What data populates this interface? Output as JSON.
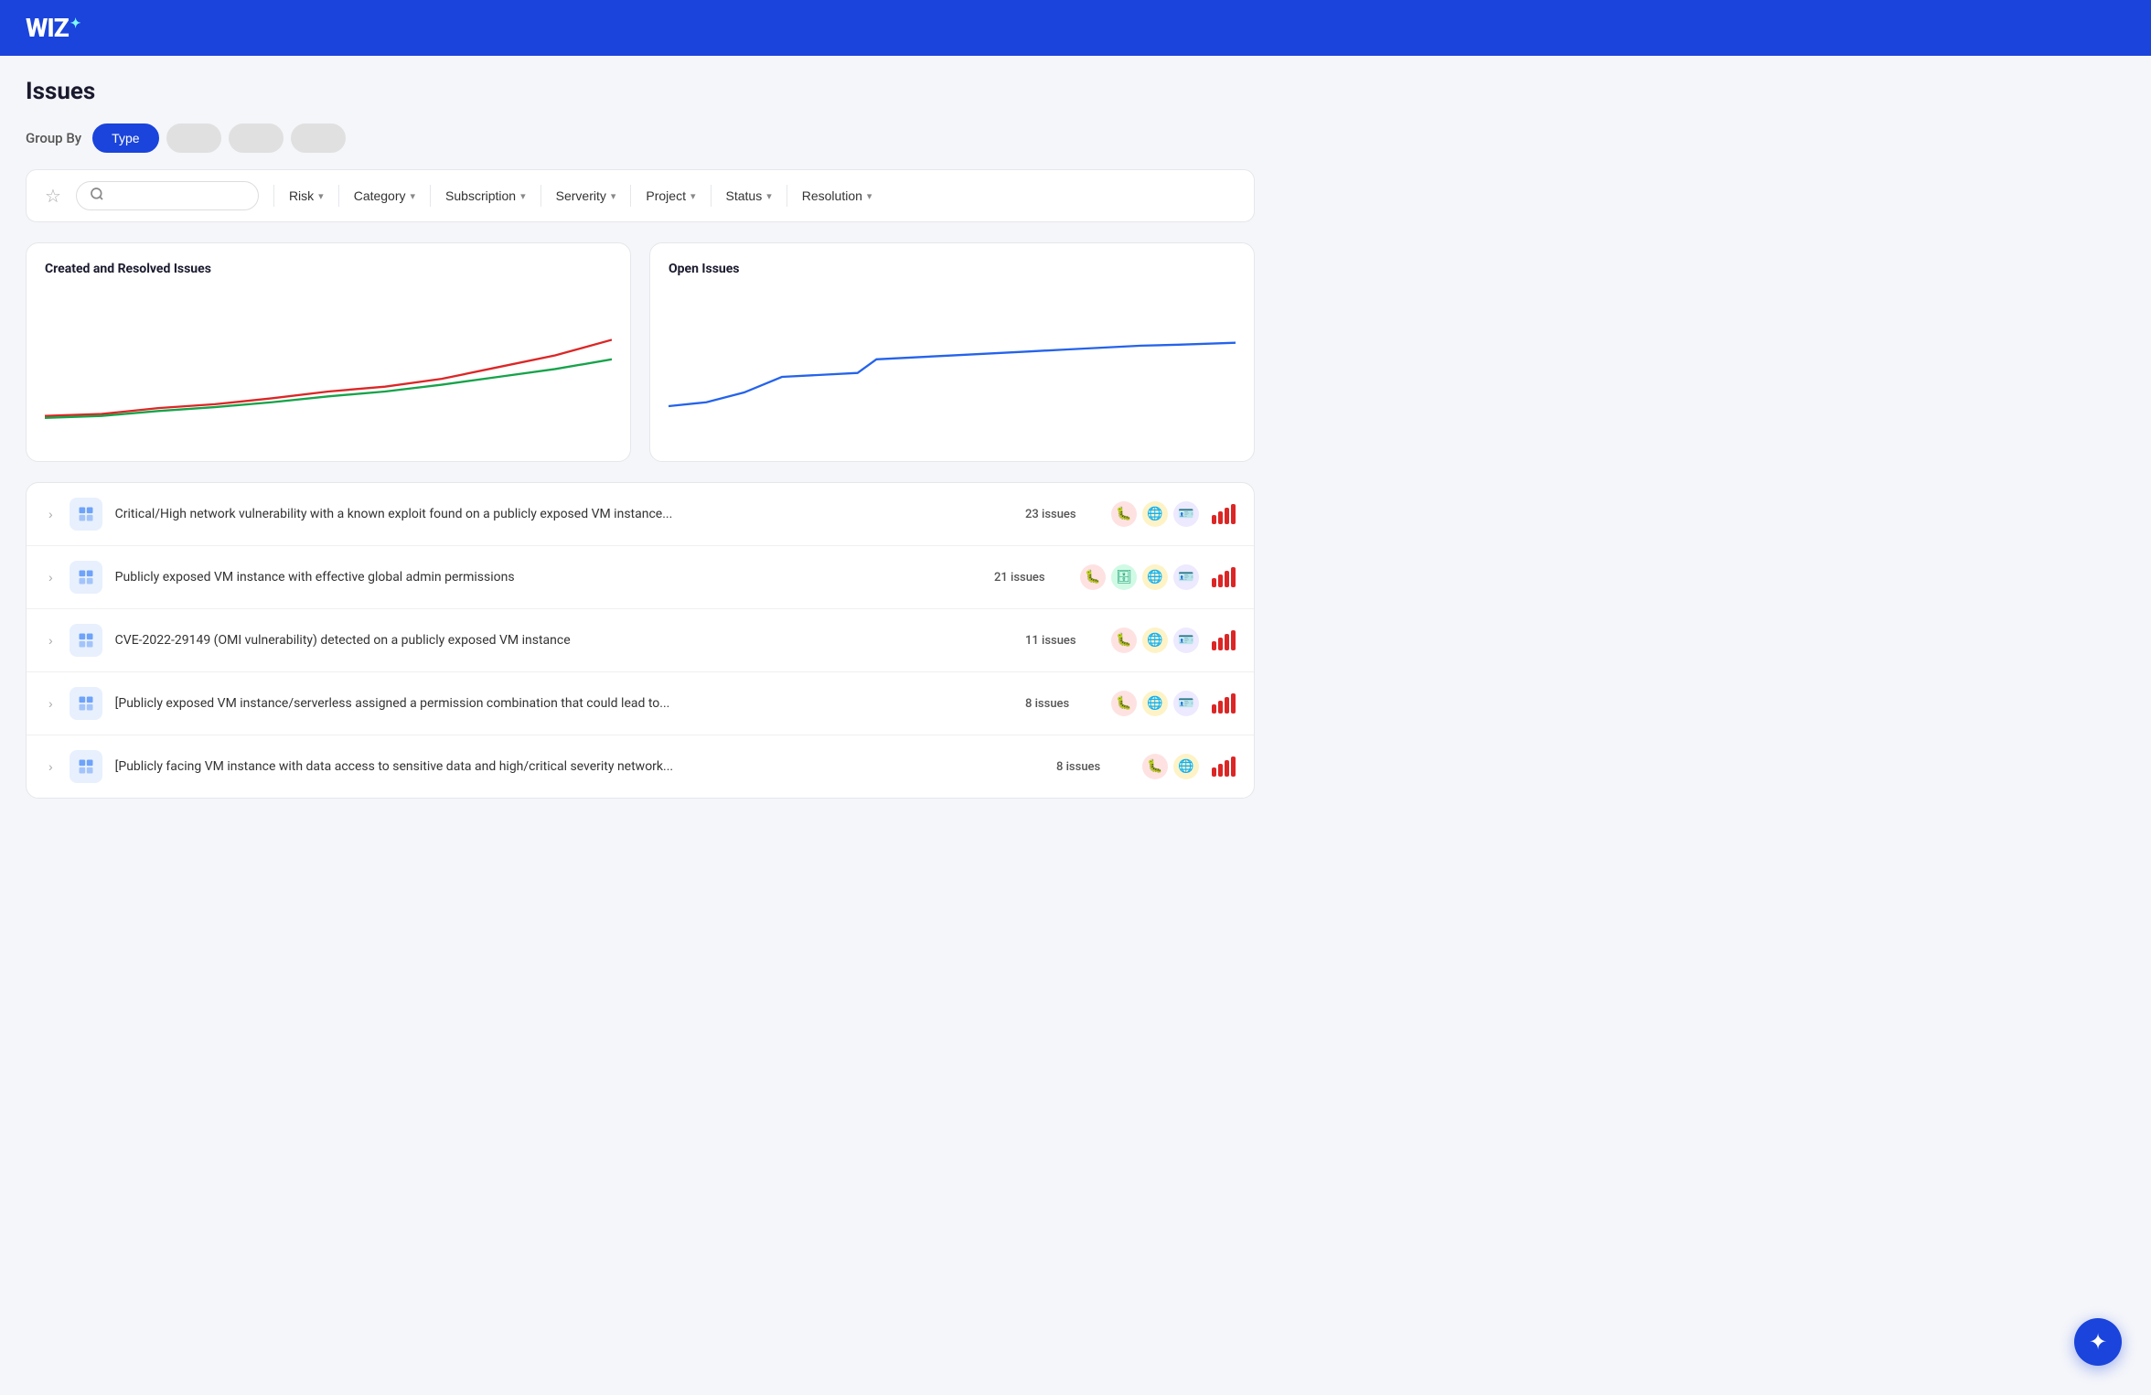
{
  "header": {
    "logo": "WIZ",
    "logo_star": "✦"
  },
  "page": {
    "title": "Issues"
  },
  "group_by": {
    "label": "Group By",
    "buttons": [
      {
        "id": "type",
        "label": "Type",
        "active": true
      },
      {
        "id": "btn2",
        "label": "",
        "active": false,
        "placeholder": true
      },
      {
        "id": "btn3",
        "label": "",
        "active": false,
        "placeholder": true
      },
      {
        "id": "btn4",
        "label": "",
        "active": false,
        "placeholder": true
      }
    ]
  },
  "filters": {
    "star_label": "☆",
    "search_placeholder": "",
    "items": [
      {
        "id": "risk",
        "label": "Risk"
      },
      {
        "id": "category",
        "label": "Category"
      },
      {
        "id": "subscription",
        "label": "Subscription"
      },
      {
        "id": "severity",
        "label": "Serverity"
      },
      {
        "id": "project",
        "label": "Project"
      },
      {
        "id": "status",
        "label": "Status"
      },
      {
        "id": "resolution",
        "label": "Resolution"
      }
    ]
  },
  "charts": {
    "left": {
      "title": "Created and Resolved Issues"
    },
    "right": {
      "title": "Open Issues"
    }
  },
  "issues": [
    {
      "id": 1,
      "text": "Critical/High network vulnerability with a known exploit found on a publicly exposed VM instance...",
      "count": "23 issues",
      "tags": [
        "bug-red",
        "globe-orange",
        "id-purple"
      ],
      "bars": [
        4,
        4,
        4,
        4
      ]
    },
    {
      "id": 2,
      "text": "Publicly exposed VM instance with effective global admin permissions",
      "count": "21 issues",
      "tags": [
        "bug-red",
        "db-green",
        "globe-orange",
        "id-purple"
      ],
      "bars": [
        4,
        4,
        4,
        4
      ]
    },
    {
      "id": 3,
      "text": "CVE-2022-29149 (OMI vulnerability) detected on a publicly exposed VM instance",
      "count": "11 issues",
      "tags": [
        "bug-red",
        "globe-orange",
        "id-purple"
      ],
      "bars": [
        4,
        4,
        4,
        4
      ]
    },
    {
      "id": 4,
      "text": "[Publicly exposed VM instance/serverless assigned a permission combination that could lead to...",
      "count": "8 issues",
      "tags": [
        "bug-red",
        "globe-orange",
        "id-purple"
      ],
      "bars": [
        4,
        4,
        4,
        4
      ]
    },
    {
      "id": 5,
      "text": "[Publicly facing VM instance with data access to sensitive data and high/critical severity network...",
      "count": "8 issues",
      "tags": [
        "bug-red",
        "globe-orange"
      ],
      "bars": [
        4,
        4,
        4,
        4
      ]
    }
  ],
  "fab": {
    "icon": "✦"
  }
}
